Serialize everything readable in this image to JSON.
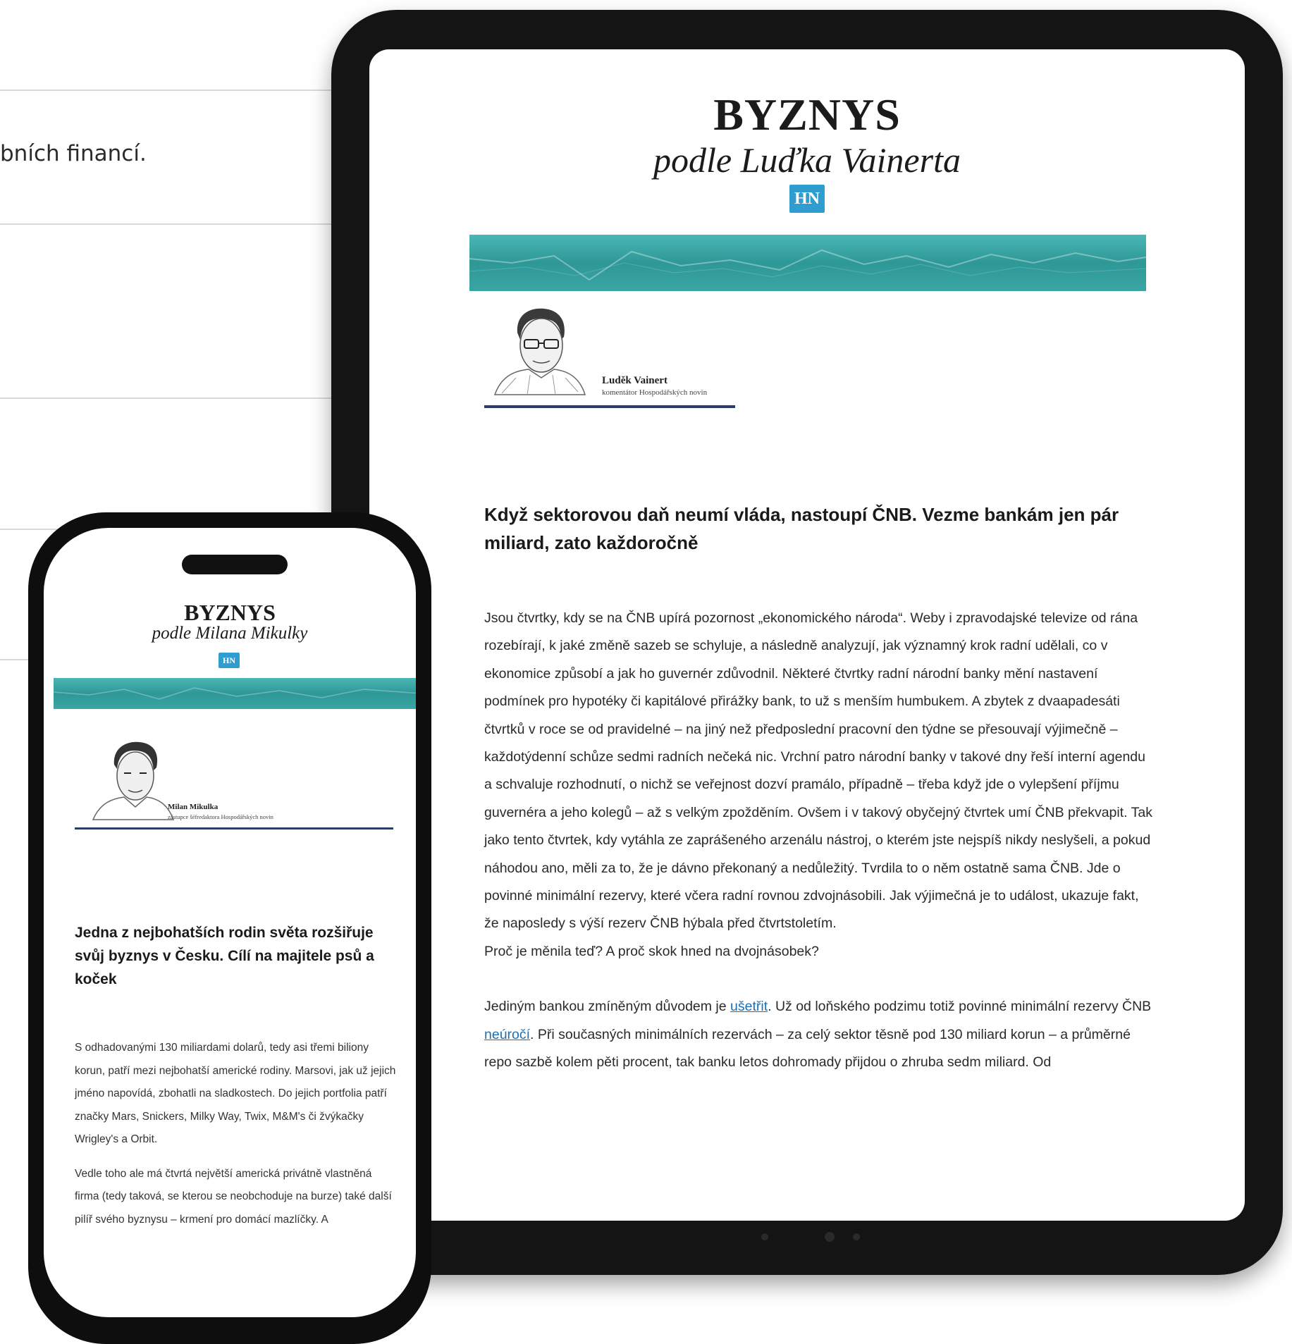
{
  "background": {
    "partial_text": "bních financí."
  },
  "tablet": {
    "brand_main": "BYZNYS",
    "brand_sub": "podle Luďka Vainerta",
    "badge": "HN",
    "author_name": "Luděk Vainert",
    "author_role": "komentátor Hospodářských novin",
    "headline": "Když sektorovou daň neumí vláda, nastoupí ČNB. Vezme bankám jen pár miliard, zato každoročně",
    "body_p1": "Jsou čtvrtky, kdy se na ČNB upírá pozornost „ekonomického národa“. Weby i zpravodajské televize od rána rozebírají, k jaké změně sazeb se schyluje, a následně analyzují, jak významný krok radní udělali, co v ekonomice způsobí a jak ho guvernér zdůvodnil. Některé čtvrtky radní národní banky mění nastavení podmínek pro hypotéky či kapitálové přirážky bank, to už s menším humbukem. A zbytek z dvaapadesáti čtvrtků v roce se od pravidelné – na jiný než předposlední pracovní den týdne se přesouvají výjimečně – každotýdenní schůze sedmi radních nečeká nic. Vrchní patro národní banky v takové dny řeší interní agendu a schvaluje rozhodnutí, o nichž se veřejnost dozví pramálo, případně – třeba když jde o vylepšení příjmu guvernéra a jeho kolegů – až s velkým zpožděním. Ovšem i v takový obyčejný čtvrtek umí ČNB překvapit. Tak jako tento čtvrtek, kdy vytáhla ze zaprášeného arzenálu nástroj, o kterém jste nejspíš nikdy neslyšeli, a pokud náhodou ano, měli za to, že je dávno překonaný a nedůležitý. Tvrdila to o něm ostatně sama ČNB. Jde o povinné minimální rezervy, které včera radní rovnou zdvojnásobili. Jak výjimečná je to událost, ukazuje fakt, že naposledy s výší rezerv ČNB hýbala před čtvrtstoletím.",
    "body_p2": "Proč je měnila teď?  A proč skok hned na dvojnásobek?",
    "body_p3_a": "Jediným bankou zmíněným důvodem je ",
    "body_p3_link1": "ušetřit",
    "body_p3_b": ". Už od loňského podzimu totiž povinné minimální rezervy ČNB ",
    "body_p3_link2": "neúročí",
    "body_p3_c": ". Při současných minimálních rezervách – za celý sektor těsně pod 130 miliard korun – a průměrné repo sazbě kolem pěti procent, tak banku letos dohromady přijdou o zhruba sedm miliard. Od"
  },
  "phone": {
    "brand_main": "BYZNYS",
    "brand_sub": "podle Milana Mikulky",
    "badge": "HN",
    "author_name": "Milan Mikulka",
    "author_role": "zástupce šéfredaktora Hospodářských novin",
    "headline": "Jedna z nejbohatších rodin světa rozšiřuje svůj byznys v Česku. Cílí na majitele psů a koček",
    "body_p1": "S odhadovanými 130 miliardami dolarů, tedy asi třemi biliony korun, patří mezi nejbohatší americké rodiny. Marsovi, jak už jejich jméno napovídá, zbohatli na sladkostech. Do jejich portfolia patří značky Mars, Snickers, Milky Way, Twix, M&M's či žvýkačky Wrigley's a Orbit.",
    "body_p2": "Vedle toho ale má čtvrtá největší americká privátně vlastněná firma (tedy taková, se kterou se neobchoduje na burze) také další pilíř svého byznysu – krmení pro domácí mazlíčky. A"
  },
  "colors": {
    "teal": "#2e9896",
    "hn_blue": "#2f9dd0",
    "rule_navy": "#2c3e66",
    "link": "#1d6fb3"
  }
}
